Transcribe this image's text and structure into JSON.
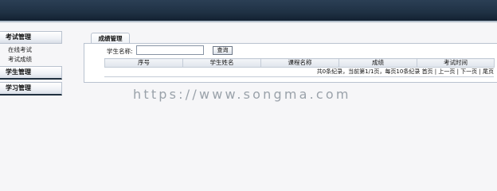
{
  "sidebar": {
    "sections": [
      {
        "title": "考试管理",
        "items": [
          "在线考试",
          "考试成绩"
        ]
      },
      {
        "title": "学生管理",
        "items": []
      },
      {
        "title": "学习管理",
        "items": []
      }
    ]
  },
  "main": {
    "tab_label": "成绩管理",
    "search": {
      "label": "学生名称:",
      "value": "",
      "placeholder": "",
      "button_label": "查询"
    },
    "table": {
      "columns": [
        "序号",
        "学生姓名",
        "课程名称",
        "成绩",
        "考试时间"
      ]
    },
    "pager": {
      "summary": "共0条纪录，当前第1/1页，每页10条纪录",
      "first": "首页",
      "prev": "上一页",
      "next": "下一页",
      "last": "尾页",
      "separator": " | "
    }
  },
  "watermark": "https://www.songma.com"
}
